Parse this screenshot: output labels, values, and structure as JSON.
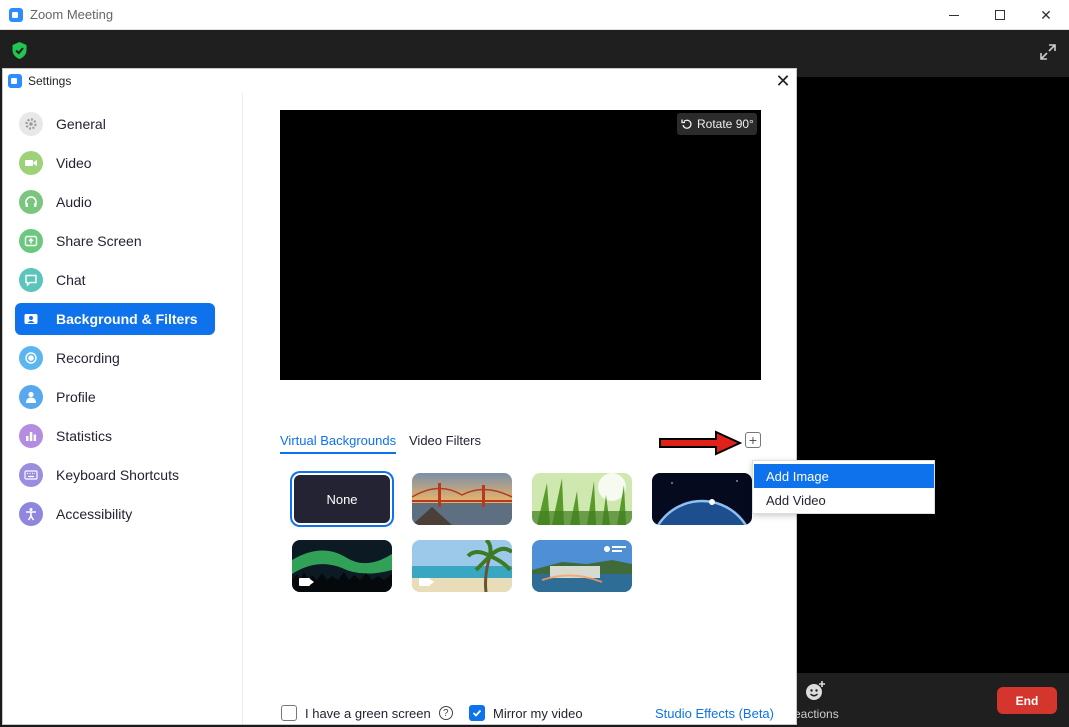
{
  "outer_window": {
    "title": "Zoom Meeting",
    "reactions_label": "eactions",
    "end_label": "End"
  },
  "settings": {
    "title": "Settings",
    "sidebar": {
      "items": [
        {
          "label": "General",
          "icon": "gear-icon",
          "color": "#e8e8e8"
        },
        {
          "label": "Video",
          "icon": "video-camera-icon",
          "color": "#9ed27a"
        },
        {
          "label": "Audio",
          "icon": "headphones-icon",
          "color": "#7bc67e"
        },
        {
          "label": "Share Screen",
          "icon": "share-screen-icon",
          "color": "#6cc77f"
        },
        {
          "label": "Chat",
          "icon": "chat-bubble-icon",
          "color": "#5bc4bb"
        },
        {
          "label": "Background & Filters",
          "icon": "person-portrait-icon",
          "color": "#0e72ed"
        },
        {
          "label": "Recording",
          "icon": "record-icon",
          "color": "#5bb6f0"
        },
        {
          "label": "Profile",
          "icon": "profile-icon",
          "color": "#58a8f0"
        },
        {
          "label": "Statistics",
          "icon": "bar-chart-icon",
          "color": "#b58de0"
        },
        {
          "label": "Keyboard Shortcuts",
          "icon": "keyboard-icon",
          "color": "#9b8ee0"
        },
        {
          "label": "Accessibility",
          "icon": "accessibility-icon",
          "color": "#8f86dd"
        }
      ],
      "active_index": 5
    },
    "preview": {
      "rotate_label": "Rotate 90°"
    },
    "tabs": [
      {
        "label": "Virtual Backgrounds",
        "active": true
      },
      {
        "label": "Video Filters",
        "active": false
      }
    ],
    "backgrounds": {
      "none_label": "None",
      "items": [
        {
          "name": "golden-gate-bridge",
          "type": "image"
        },
        {
          "name": "grass",
          "type": "image"
        },
        {
          "name": "earth-from-space",
          "type": "image"
        },
        {
          "name": "northern-lights",
          "type": "video"
        },
        {
          "name": "beach-palm",
          "type": "video"
        },
        {
          "name": "waterfall",
          "type": "image"
        }
      ]
    },
    "add_menu": {
      "items": [
        "Add Image",
        "Add Video"
      ],
      "highlighted_index": 0
    },
    "options": {
      "green_screen_label": "I have a green screen",
      "green_screen_checked": false,
      "mirror_label": "Mirror my video",
      "mirror_checked": true,
      "studio_effects_label": "Studio Effects (Beta)"
    }
  },
  "colors": {
    "accent": "#0e72ed",
    "end_red": "#d4352c",
    "annotation_arrow": "#e0201a"
  }
}
